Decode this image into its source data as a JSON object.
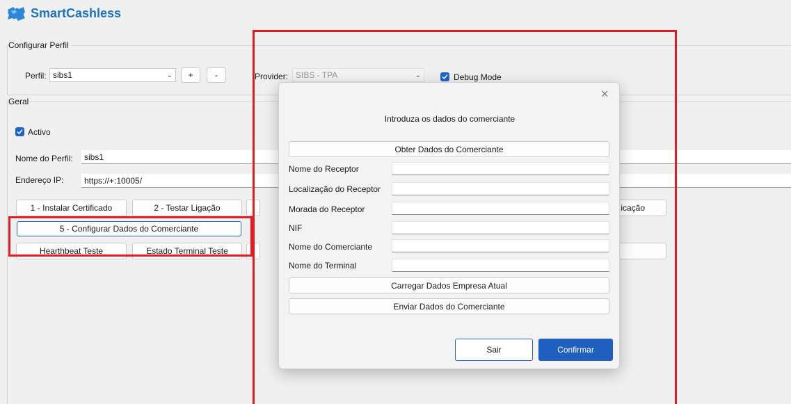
{
  "app": {
    "title": "SmartCashless"
  },
  "config_group": {
    "label": "Configurar Perfil",
    "perfil_label": "Perfil:",
    "perfil_value": "sibs1",
    "add_label": "+",
    "remove_label": "-",
    "provider_label": "Provider:",
    "provider_value": "SIBS - TPA",
    "debug_label": "Debug Mode",
    "debug_checked": true
  },
  "geral_group": {
    "label": "Geral",
    "activo_label": "Activo",
    "activo_checked": true,
    "nome_label": "Nome do Perfil:",
    "nome_value": "sibs1",
    "ip_label": "Endereço IP:",
    "ip_value": "https://+:10005/",
    "buttons": {
      "b1": "1 - Instalar Certificado",
      "b2": "2 - Testar Ligação",
      "b4_partial": "icação",
      "b5": "5 - Configurar Dados do Comerciante",
      "b6": "Hearthbeat Teste",
      "b7": "Estado Terminal Teste"
    }
  },
  "modal": {
    "close_glyph": "×",
    "heading": "Introduza os dados do comerciante",
    "obter_label": "Obter Dados do Comerciante",
    "fields": [
      {
        "label": "Nome do Receptor",
        "value": ""
      },
      {
        "label": "Localização do Receptor",
        "value": ""
      },
      {
        "label": "Morada do Receptor",
        "value": ""
      },
      {
        "label": "NIF",
        "value": ""
      },
      {
        "label": "Nome do Comerciante",
        "value": ""
      },
      {
        "label": "Nome do Terminal",
        "value": ""
      }
    ],
    "carregar_label": "Carregar Dados Empresa Atual",
    "enviar_label": "Enviar Dados do Comerciante",
    "sair_label": "Sair",
    "confirmar_label": "Confirmar"
  },
  "colors": {
    "accent": "#1f5fc0",
    "highlight_box": "#e31b23",
    "logo": "#1e73be"
  },
  "icons": {
    "logo": "puzzle-logo-icon",
    "chevron": "chevron-down-icon",
    "check": "check-icon",
    "close": "close-icon"
  }
}
